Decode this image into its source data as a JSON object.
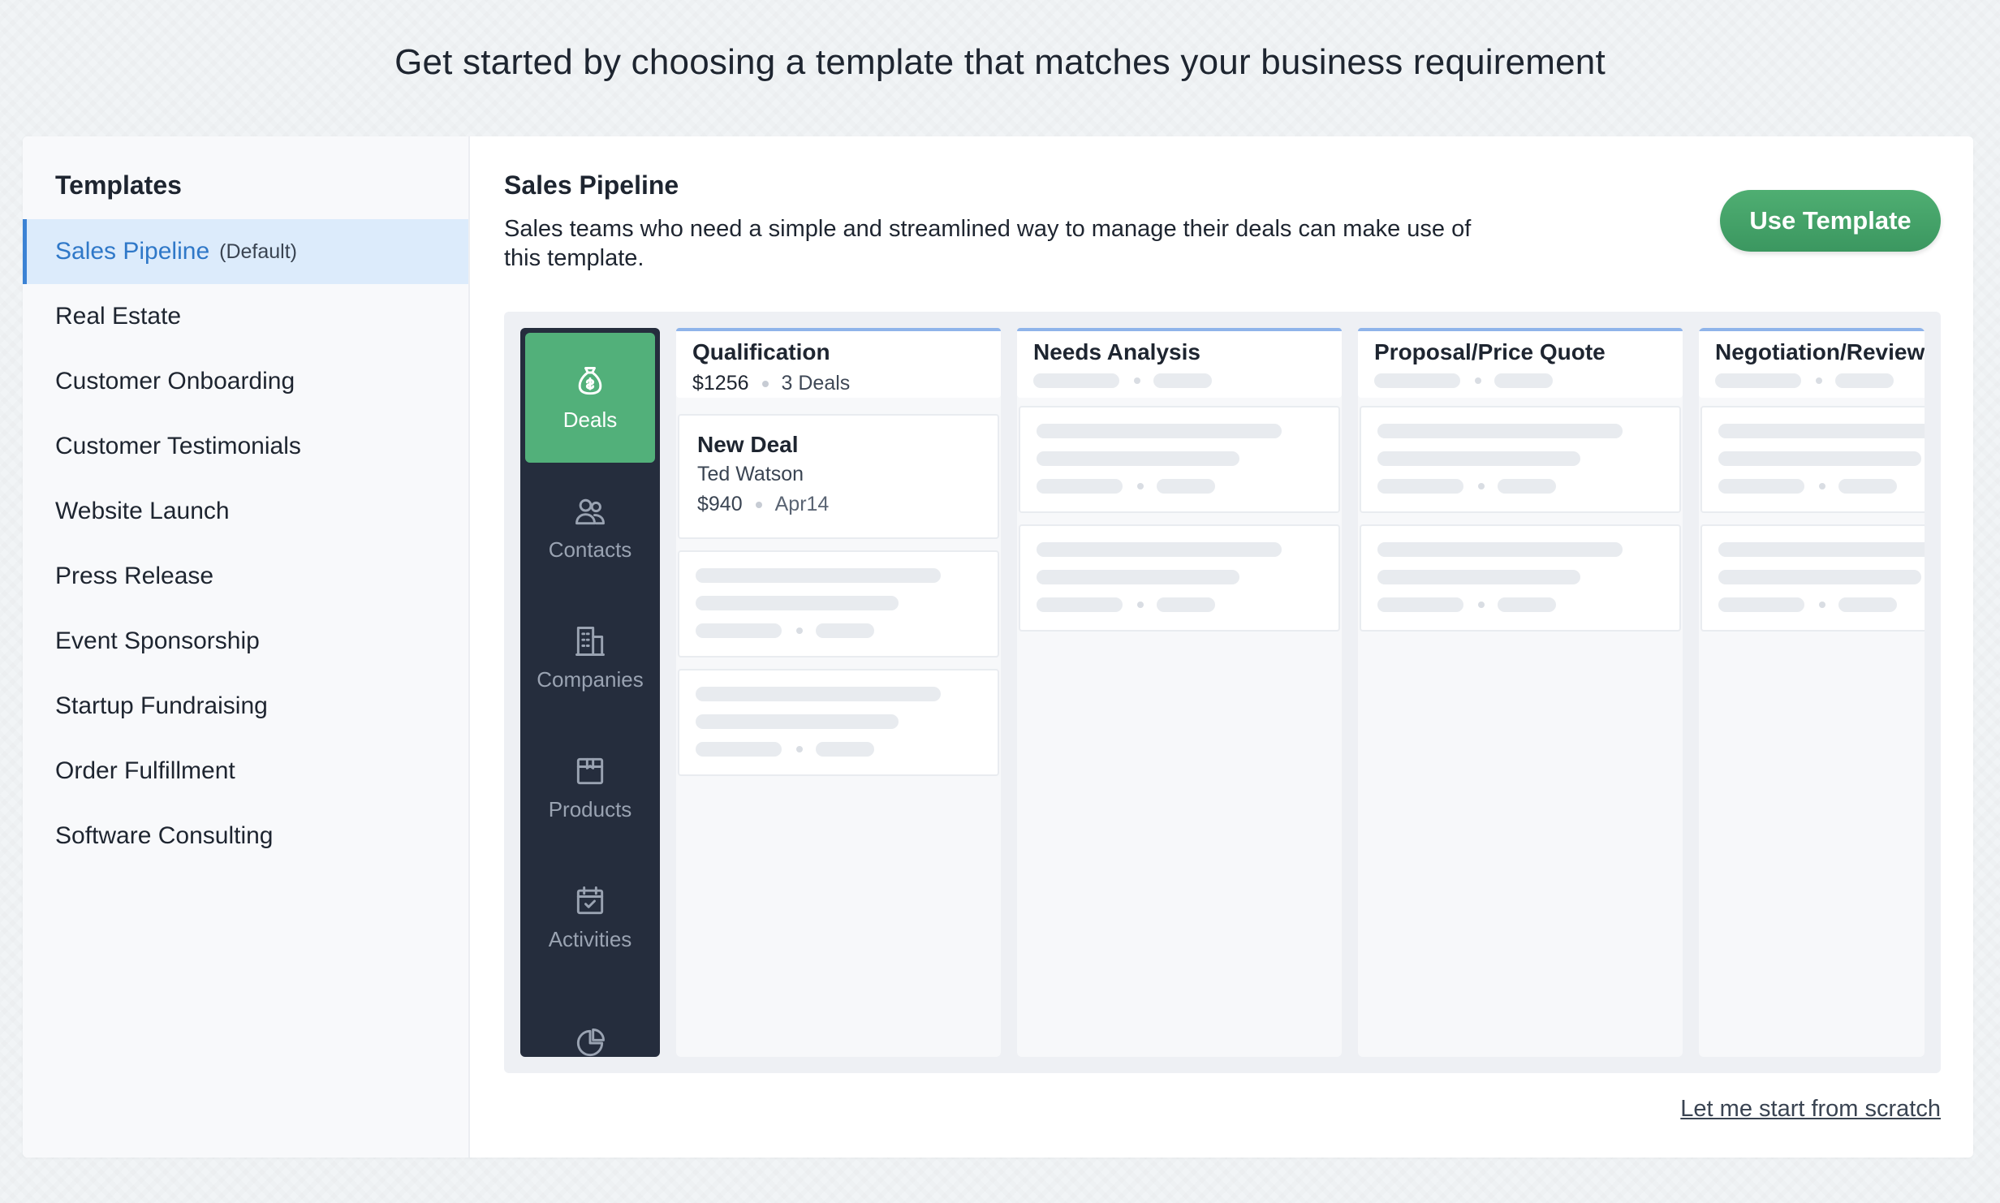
{
  "header": {
    "title": "Get started by choosing a template that matches your business requirement"
  },
  "sidebar": {
    "title": "Templates",
    "items": [
      {
        "label": "Sales Pipeline",
        "tag": "(Default)"
      },
      {
        "label": "Real Estate"
      },
      {
        "label": "Customer Onboarding"
      },
      {
        "label": "Customer Testimonials"
      },
      {
        "label": "Website Launch"
      },
      {
        "label": "Press Release"
      },
      {
        "label": "Event Sponsorship"
      },
      {
        "label": "Startup Fundraising"
      },
      {
        "label": "Order Fulfillment"
      },
      {
        "label": "Software Consulting"
      }
    ]
  },
  "detail": {
    "name": "Sales Pipeline",
    "description": "Sales teams who need a simple and streamlined way to manage their deals can make use of this template.",
    "use_button": "Use Template",
    "scratch_link": "Let me start from scratch"
  },
  "preview": {
    "nav": [
      {
        "label": "Deals",
        "icon": "money-bag-icon"
      },
      {
        "label": "Contacts",
        "icon": "contacts-icon"
      },
      {
        "label": "Companies",
        "icon": "building-icon"
      },
      {
        "label": "Products",
        "icon": "box-icon"
      },
      {
        "label": "Activities",
        "icon": "calendar-check-icon"
      },
      {
        "label": "",
        "icon": "pie-chart-icon"
      }
    ],
    "columns": [
      {
        "title": "Qualification",
        "amount": "$1256",
        "count": "3 Deals"
      },
      {
        "title": "Needs Analysis"
      },
      {
        "title": "Proposal/Price Quote"
      },
      {
        "title": "Negotiation/Review"
      }
    ],
    "deal_card": {
      "title": "New Deal",
      "contact": "Ted Watson",
      "amount": "$940",
      "date": "Apr14"
    }
  },
  "colors": {
    "accent_blue": "#3b82d4",
    "active_bg": "#dcebfb",
    "green": "#52b07a",
    "nav_bg": "#252d3d"
  }
}
